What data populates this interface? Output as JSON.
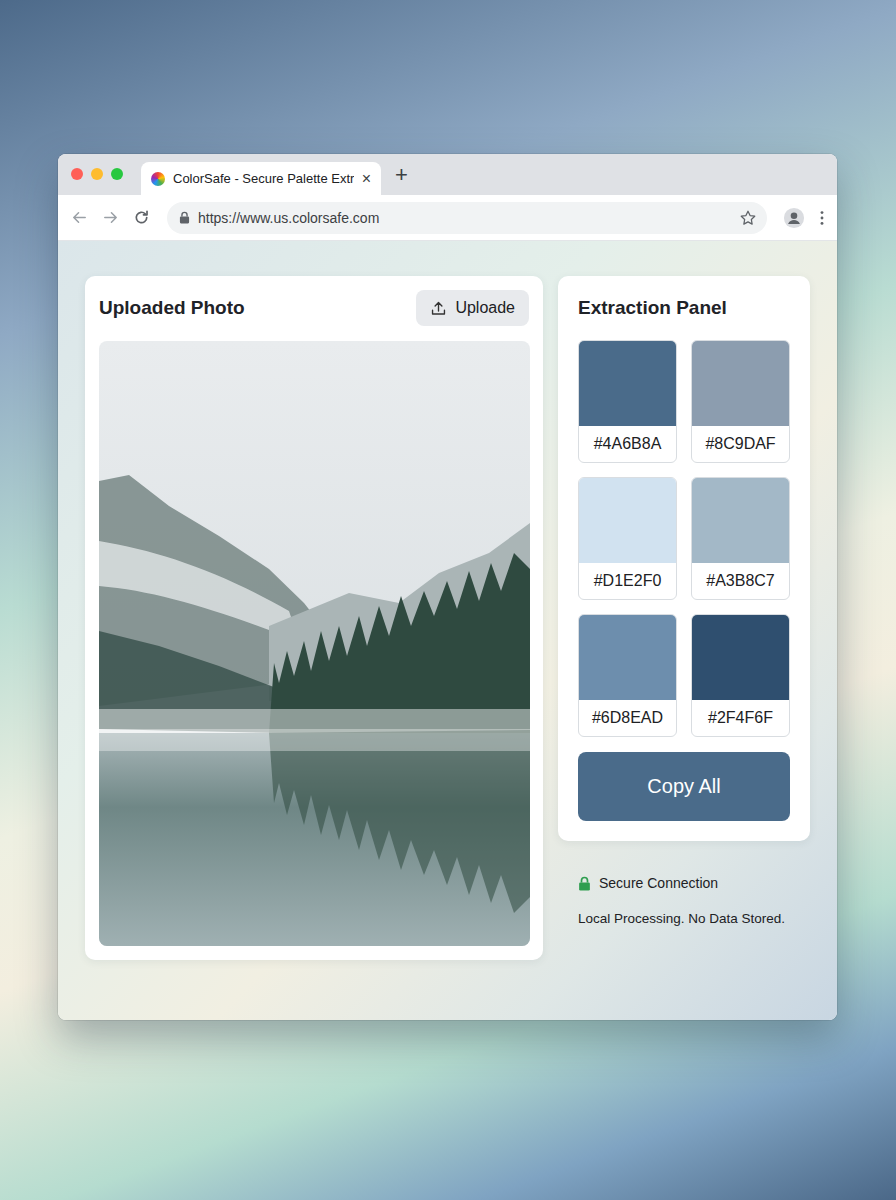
{
  "browser": {
    "tab": {
      "title": "ColorSafe - Secure Palette Extr",
      "close": "×",
      "selected": true
    },
    "new_tab": "+",
    "url": "https://www.us.colorsafe.com"
  },
  "photo_panel": {
    "title": "Uploaded Photo",
    "upload_button": "Uploade"
  },
  "extraction_panel": {
    "title": "Extraction Panel",
    "swatches": [
      {
        "hex": "#4A6B8A",
        "color": "#4a6b8a"
      },
      {
        "hex": "#8C9DAF",
        "color": "#8c9daf"
      },
      {
        "hex": "#D1E2F0",
        "color": "#d1e2f0"
      },
      {
        "hex": "#A3B8C7",
        "color": "#a3b8c7"
      },
      {
        "hex": "#6D8EAD",
        "color": "#6d8ead"
      },
      {
        "hex": "#2F4F6F",
        "color": "#2f4f6f"
      }
    ],
    "copy_button": "Copy All"
  },
  "footer": {
    "secure": "Secure Connection",
    "note": "Local Processing. No Data Stored."
  }
}
